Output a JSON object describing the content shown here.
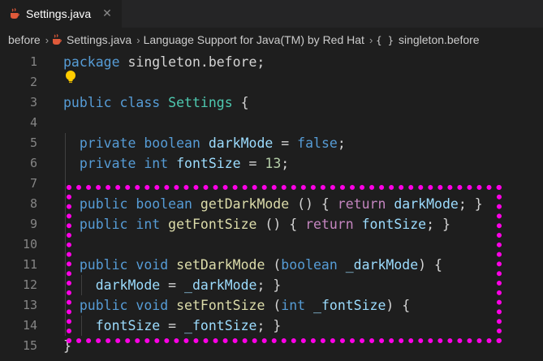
{
  "tab": {
    "filename": "Settings.java",
    "close_glyph": "✕"
  },
  "breadcrumb": {
    "folder": "before",
    "file": "Settings.java",
    "provider": "Language Support for Java(TM) by Red Hat",
    "symbol_icon": "{ }",
    "symbol": "singleton.before"
  },
  "line_numbers": [
    "1",
    "2",
    "3",
    "4",
    "5",
    "6",
    "7",
    "8",
    "9",
    "10",
    "11",
    "12",
    "13",
    "14",
    "15"
  ],
  "code": {
    "l1_kw": "package",
    "l1_rest": " singleton.before;",
    "l3_kw1": "public",
    "l3_kw2": "class",
    "l3_type": "Settings",
    "l3_rest": " {",
    "l5_kw1": "private",
    "l5_kw2": "boolean",
    "l5_var": "darkMode",
    "l5_eq": " = ",
    "l5_val": "false",
    "l5_end": ";",
    "l6_kw1": "private",
    "l6_kw2": "int",
    "l6_var": "fontSize",
    "l6_eq": " = ",
    "l6_val": "13",
    "l6_end": ";",
    "l8_kw1": "public",
    "l8_kw2": "boolean",
    "l8_fn": "getDarkMode",
    "l8_mid": " () { ",
    "l8_ret": "return",
    "l8_var": "darkMode",
    "l8_end": "; }",
    "l9_kw1": "public",
    "l9_kw2": "int",
    "l9_fn": "getFontSize",
    "l9_mid": " () { ",
    "l9_ret": "return",
    "l9_var": "fontSize",
    "l9_end": "; }",
    "l11_kw1": "public",
    "l11_kw2": "void",
    "l11_fn": "setDarkMode",
    "l11_mid": " (",
    "l11_kw3": "boolean",
    "l11_param": "_darkMode",
    "l11_end": ") {",
    "l12_var": "darkMode",
    "l12_eq": " = ",
    "l12_param": "_darkMode",
    "l12_end": "; }",
    "l13_kw1": "public",
    "l13_kw2": "void",
    "l13_fn": "setFontSize",
    "l13_mid": " (",
    "l13_kw3": "int",
    "l13_param": "_fontSize",
    "l13_end": ") {",
    "l14_var": "fontSize",
    "l14_eq": " = ",
    "l14_param": "_fontSize",
    "l14_end": "; }",
    "l15": "}"
  },
  "icons": [
    "java-file-icon",
    "close-icon",
    "lightbulb-icon",
    "symbol-namespace-icon"
  ],
  "colors": {
    "highlight_border": "#ff00e6",
    "editor_bg": "#1e1e1e",
    "keyword": "#569cd6",
    "type": "#4ec9b0",
    "variable": "#9cdcfe",
    "function": "#dcdcaa",
    "control": "#c586c0",
    "number": "#b5cea8"
  }
}
